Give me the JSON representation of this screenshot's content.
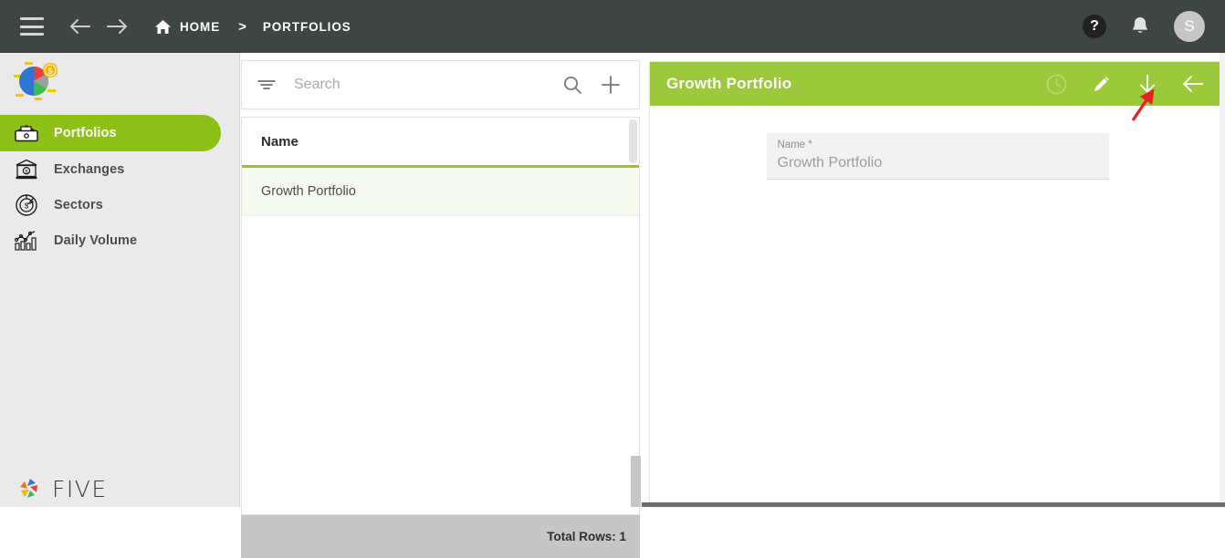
{
  "topbar": {
    "menu_icon": "hamburger-menu-icon",
    "back_icon": "arrow-left-icon",
    "forward_icon": "arrow-right-icon",
    "home_icon": "home-icon",
    "breadcrumbs": [
      {
        "label": "HOME"
      },
      {
        "label": "PORTFOLIOS"
      }
    ],
    "separator": ">",
    "help_label": "?",
    "help_icon": "question-mark-circle-icon",
    "notification_icon": "bell-icon",
    "avatar_initial": "S"
  },
  "sidebar": {
    "logo_icon": "pie-chart-coin-logo-icon",
    "items": [
      {
        "label": "Portfolios",
        "icon": "wallet-icon",
        "active": true
      },
      {
        "label": "Exchanges",
        "icon": "bank-icon",
        "active": false
      },
      {
        "label": "Sectors",
        "icon": "pie-chart-dollar-icon",
        "active": false
      },
      {
        "label": "Daily Volume",
        "icon": "bar-chart-trend-icon",
        "active": false
      }
    ],
    "brand_name": "FIVE",
    "brand_icon": "five-star-logo-icon"
  },
  "list_panel": {
    "filter_icon": "filter-icon",
    "search_placeholder": "Search",
    "search_value": "",
    "search_icon": "magnifier-icon",
    "add_icon": "plus-icon",
    "columns": [
      "Name"
    ],
    "rows": [
      {
        "name": "Growth Portfolio"
      }
    ],
    "footer_label": "Total Rows: 1"
  },
  "detail_panel": {
    "title": "Growth Portfolio",
    "actions": [
      {
        "name": "history-clock-icon",
        "label": "History"
      },
      {
        "name": "pencil-edit-icon",
        "label": "Edit"
      },
      {
        "name": "arrow-down-icon",
        "label": "Download"
      },
      {
        "name": "arrow-left-back-icon",
        "label": "Back"
      }
    ],
    "fields": [
      {
        "label": "Name *",
        "value": "Growth Portfolio"
      }
    ]
  },
  "annotation": {
    "type": "red-arrow",
    "color": "#e8201f",
    "points_to": "arrow-down-icon"
  },
  "colors": {
    "topbar_bg": "#3e4543",
    "sidebar_bg": "#eaeaea",
    "accent_green": "#8dc117",
    "header_green": "#9cc83c",
    "grid_underline": "#9cc523",
    "row_highlight": "#f6f9ef",
    "footer_gray": "#c6c6c6",
    "field_bg": "#f2f2f2"
  }
}
